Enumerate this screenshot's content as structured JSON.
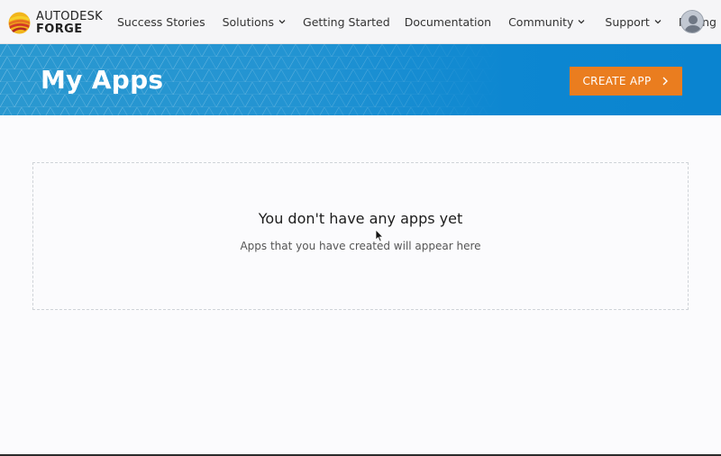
{
  "brand": {
    "line1": "AUTODESK",
    "line2": "FORGE",
    "mark_colors": [
      "#f2b51c",
      "#e8711f",
      "#d33b27"
    ]
  },
  "nav": {
    "success_stories": "Success Stories",
    "solutions": "Solutions",
    "getting_started": "Getting Started",
    "documentation": "Documentation",
    "community": "Community",
    "support": "Support",
    "pricing": "Pricing"
  },
  "banner": {
    "title": "My Apps",
    "create_button": "CREATE APP",
    "background_color": "#0a84d0",
    "button_color": "#ea7d1f"
  },
  "empty_state": {
    "title": "You don't have any apps yet",
    "subtitle": "Apps that you have created will appear here"
  },
  "icons": {
    "logo": "autodesk-forge-logo-icon",
    "dropdown": "chevron-down-icon",
    "button_arrow": "chevron-right-icon",
    "avatar": "user-avatar-icon",
    "cursor": "mouse-cursor-icon"
  }
}
